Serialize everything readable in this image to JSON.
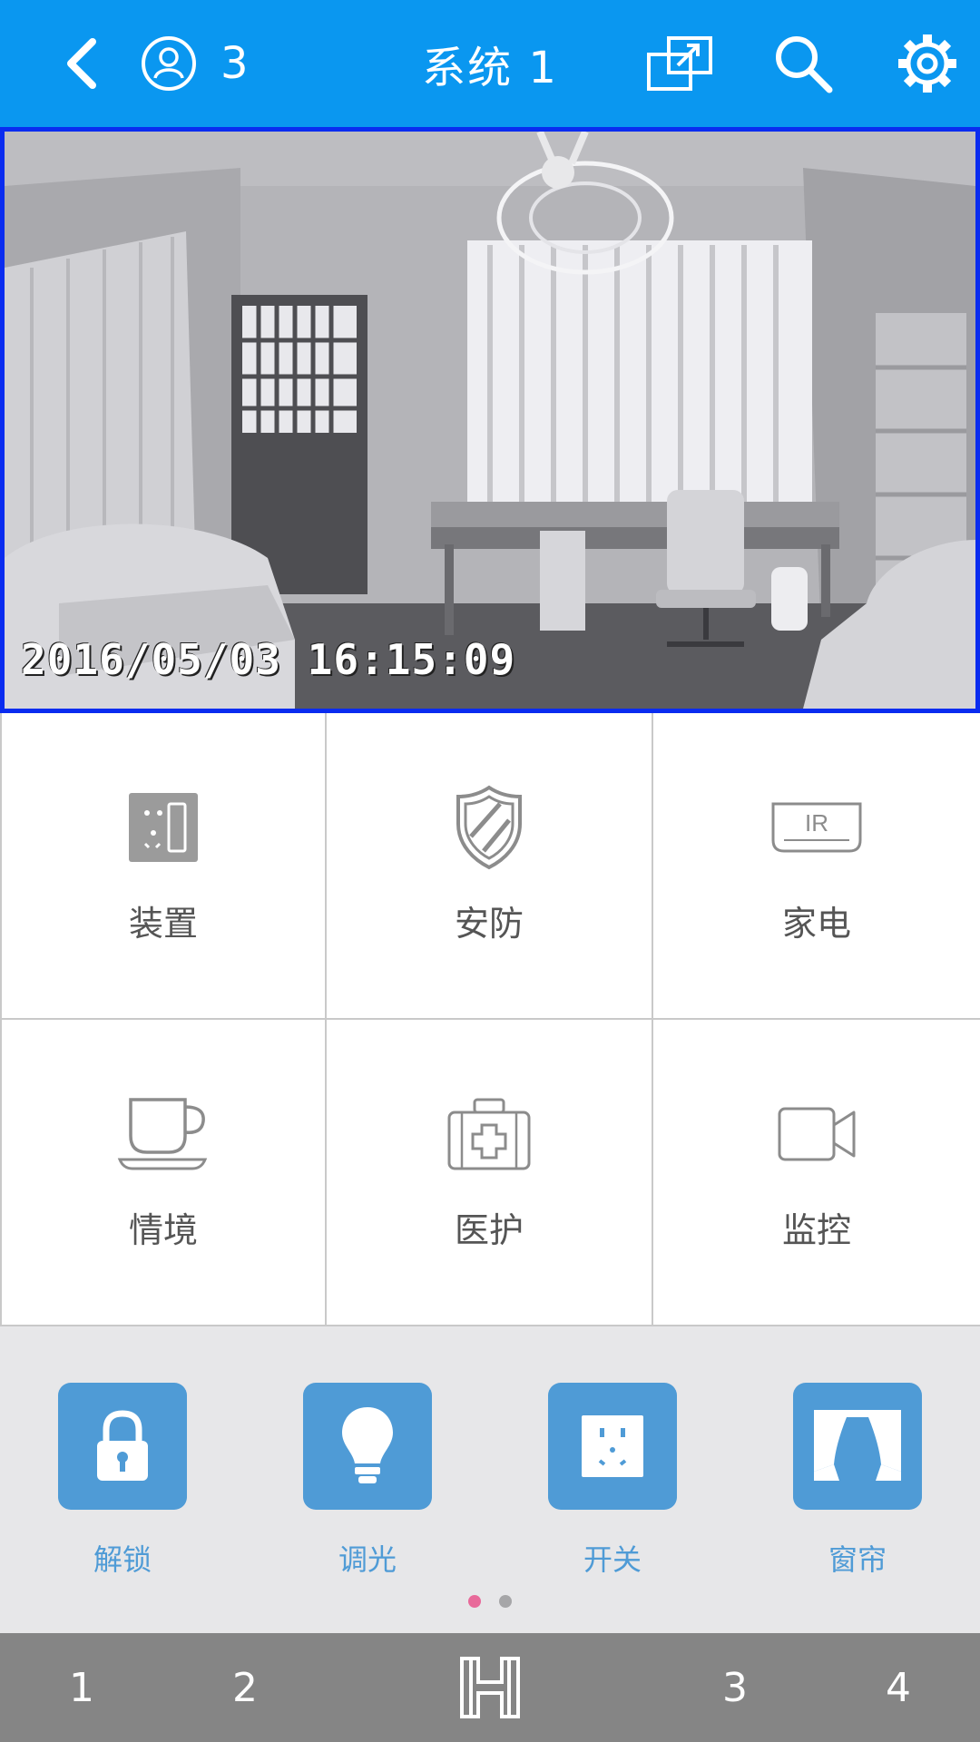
{
  "header": {
    "title": "系统 1",
    "user_count": "3",
    "icons": [
      "back-icon",
      "user-icon",
      "share-icon",
      "search-icon",
      "gear-icon"
    ],
    "background_color": "#0a97f0"
  },
  "camera": {
    "timestamp": "2016/05/03 16:15:09",
    "border_color": "#0a2cf0"
  },
  "categories": [
    {
      "label": "装置",
      "icon": "device-icon"
    },
    {
      "label": "安防",
      "icon": "shield-icon"
    },
    {
      "label": "家电",
      "icon": "ir-remote-icon"
    },
    {
      "label": "情境",
      "icon": "cup-icon"
    },
    {
      "label": "医护",
      "icon": "medical-kit-icon"
    },
    {
      "label": "监控",
      "icon": "video-camera-icon"
    }
  ],
  "quick_controls": [
    {
      "label": "解锁",
      "icon": "lock-icon"
    },
    {
      "label": "调光",
      "icon": "bulb-icon"
    },
    {
      "label": "开关",
      "icon": "switch-icon"
    },
    {
      "label": "窗帘",
      "icon": "curtain-icon"
    }
  ],
  "pager": {
    "pages": 2,
    "active": 1,
    "active_color": "#e86a9a"
  },
  "bottom_bar": {
    "tabs": [
      "1",
      "2",
      "3",
      "4"
    ],
    "home_icon": "home-h-icon"
  },
  "accent_color": "#4f9bd6"
}
